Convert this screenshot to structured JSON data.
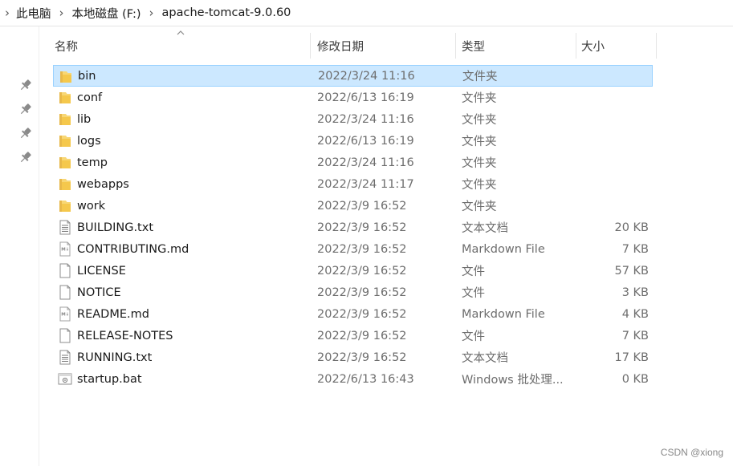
{
  "breadcrumb": [
    "此电脑",
    "本地磁盘 (F:)",
    "apache-tomcat-9.0.60"
  ],
  "columns": {
    "name": "名称",
    "date": "修改日期",
    "type": "类型",
    "size": "大小"
  },
  "files": [
    {
      "name": "bin",
      "date": "2022/3/24 11:16",
      "type": "文件夹",
      "size": "",
      "icon": "folder-icon",
      "selected": true
    },
    {
      "name": "conf",
      "date": "2022/6/13 16:19",
      "type": "文件夹",
      "size": "",
      "icon": "folder-icon"
    },
    {
      "name": "lib",
      "date": "2022/3/24 11:16",
      "type": "文件夹",
      "size": "",
      "icon": "folder-icon"
    },
    {
      "name": "logs",
      "date": "2022/6/13 16:19",
      "type": "文件夹",
      "size": "",
      "icon": "folder-icon"
    },
    {
      "name": "temp",
      "date": "2022/3/24 11:16",
      "type": "文件夹",
      "size": "",
      "icon": "folder-icon"
    },
    {
      "name": "webapps",
      "date": "2022/3/24 11:17",
      "type": "文件夹",
      "size": "",
      "icon": "folder-icon"
    },
    {
      "name": "work",
      "date": "2022/3/9 16:52",
      "type": "文件夹",
      "size": "",
      "icon": "folder-icon"
    },
    {
      "name": "BUILDING.txt",
      "date": "2022/3/9 16:52",
      "type": "文本文档",
      "size": "20 KB",
      "icon": "text-file-icon"
    },
    {
      "name": "CONTRIBUTING.md",
      "date": "2022/3/9 16:52",
      "type": "Markdown File",
      "size": "7 KB",
      "icon": "markdown-file-icon"
    },
    {
      "name": "LICENSE",
      "date": "2022/3/9 16:52",
      "type": "文件",
      "size": "57 KB",
      "icon": "blank-file-icon"
    },
    {
      "name": "NOTICE",
      "date": "2022/3/9 16:52",
      "type": "文件",
      "size": "3 KB",
      "icon": "blank-file-icon"
    },
    {
      "name": "README.md",
      "date": "2022/3/9 16:52",
      "type": "Markdown File",
      "size": "4 KB",
      "icon": "markdown-file-icon"
    },
    {
      "name": "RELEASE-NOTES",
      "date": "2022/3/9 16:52",
      "type": "文件",
      "size": "7 KB",
      "icon": "blank-file-icon"
    },
    {
      "name": "RUNNING.txt",
      "date": "2022/3/9 16:52",
      "type": "文本文档",
      "size": "17 KB",
      "icon": "text-file-icon"
    },
    {
      "name": "startup.bat",
      "date": "2022/6/13 16:43",
      "type": "Windows 批处理...",
      "size": "0 KB",
      "icon": "batch-file-icon"
    }
  ],
  "watermark": "CSDN @xiong",
  "colors": {
    "selection_bg": "#cce8ff",
    "selection_border": "#99d1ff",
    "folder": "#f8d775"
  }
}
